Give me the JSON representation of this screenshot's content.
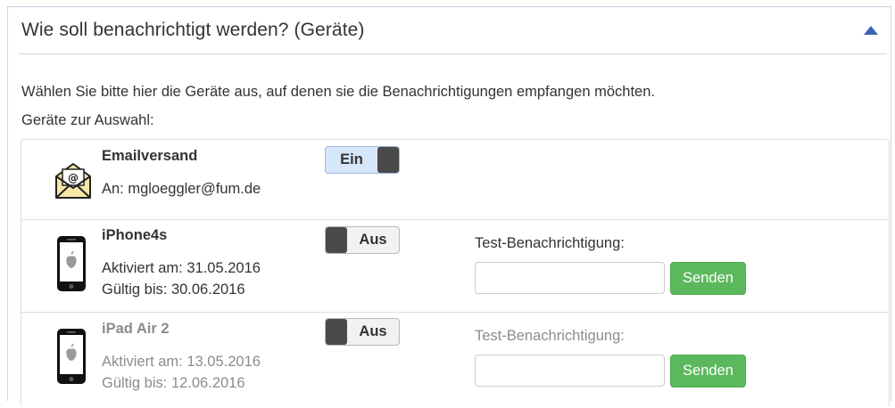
{
  "panel": {
    "title": "Wie soll benachrichtigt werden? (Geräte)",
    "collapse_icon": "triangle-up-icon",
    "accent_color": "#3c64b4"
  },
  "intro_text": "Wählen Sie bitte hier die Geräte aus, auf denen sie die Benachrichtigungen empfangen möchten.",
  "choice_label": "Geräte zur Auswahl:",
  "devices": [
    {
      "name": "Emailversand",
      "icon": "email-envelope-icon",
      "detail": "An: mgloeggler@fum.de",
      "toggle": "Ein",
      "state": "on"
    },
    {
      "name": "iPhone4s",
      "icon": "iphone-icon",
      "activated": "Aktiviert am: 31.05.2016",
      "valid_until": "Gültig bis: 30.06.2016",
      "toggle": "Aus",
      "state": "off",
      "test_label": "Test-Benachrichtigung:",
      "test_value": "",
      "send_label": "Senden"
    },
    {
      "name": "iPad Air 2",
      "icon": "ipad-icon",
      "activated": "Aktiviert am: 13.05.2016",
      "valid_until": "Gültig bis: 12.06.2016",
      "toggle": "Aus",
      "state": "off",
      "test_label": "Test-Benachrichtigung:",
      "test_value": "",
      "send_label": "Senden"
    }
  ],
  "colors": {
    "send_button": "#5cb85c",
    "toggle_on": "#d6e6fb",
    "toggle_knob": "#4a4a4a"
  }
}
